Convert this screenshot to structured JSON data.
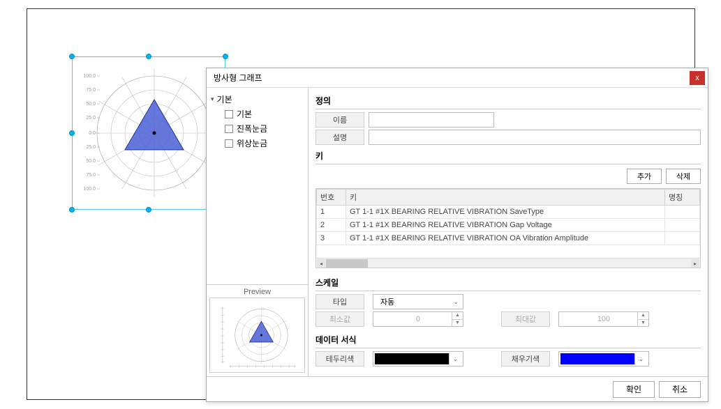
{
  "dialog": {
    "title": "방사형 그래프",
    "close": "x"
  },
  "tree": {
    "root": "기본",
    "items": [
      {
        "label": "기본"
      },
      {
        "label": "진폭눈금"
      },
      {
        "label": "위상눈금"
      }
    ]
  },
  "preview_label": "Preview",
  "definition": {
    "title": "정의",
    "name_label": "이름",
    "desc_label": "설명",
    "name_value": "",
    "desc_value": ""
  },
  "key": {
    "title": "키",
    "add_btn": "추가",
    "del_btn": "삭제",
    "headers": {
      "no": "번호",
      "key": "키",
      "alias": "명칭"
    },
    "rows": [
      {
        "no": "1",
        "key": "GT 1-1 #1X BEARING RELATIVE VIBRATION SaveType",
        "alias": ""
      },
      {
        "no": "2",
        "key": "GT 1-1 #1X BEARING RELATIVE VIBRATION Gap Voltage",
        "alias": ""
      },
      {
        "no": "3",
        "key": "GT 1-1 #1X BEARING RELATIVE VIBRATION OA Vibration Amplitude",
        "alias": ""
      }
    ]
  },
  "scale": {
    "title": "스케일",
    "type_label": "타입",
    "type_value": "자동",
    "min_label": "최소값",
    "min_value": "0",
    "max_label": "최대값",
    "max_value": "100"
  },
  "format": {
    "title": "데이터 서식",
    "border_label": "테두리색",
    "border_color": "#000000",
    "fill_label": "채우기색",
    "fill_color": "#0000ff"
  },
  "footer": {
    "ok": "확인",
    "cancel": "취소"
  },
  "radar_axis_labels": [
    "100.0",
    "75.0",
    "50.0",
    "25.0",
    "0.0",
    "25.0",
    "50.0",
    "75.0",
    "100.0"
  ]
}
